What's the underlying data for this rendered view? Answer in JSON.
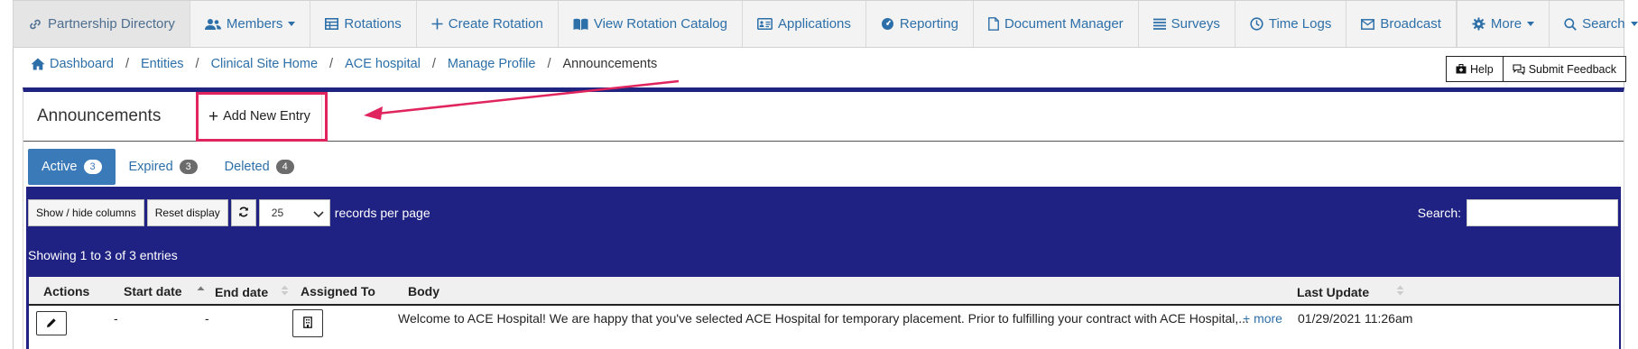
{
  "navbar": {
    "items": [
      {
        "label": "Partnership Directory",
        "icon": "link-icon",
        "active": true
      },
      {
        "label": "Members",
        "icon": "users-icon",
        "dropdown": true
      },
      {
        "label": "Rotations",
        "icon": "table-icon"
      },
      {
        "label": "Create Rotation",
        "icon": "plus-icon"
      },
      {
        "label": "View Rotation Catalog",
        "icon": "book-icon"
      },
      {
        "label": "Applications",
        "icon": "id-card-icon"
      },
      {
        "label": "Reporting",
        "icon": "dashboard-icon"
      },
      {
        "label": "Document Manager",
        "icon": "file-icon"
      },
      {
        "label": "Surveys",
        "icon": "list-icon"
      },
      {
        "label": "Time Logs",
        "icon": "clock-icon"
      },
      {
        "label": "Broadcast",
        "icon": "envelope-icon"
      }
    ],
    "more": {
      "label": "More",
      "icon": "gear-icon"
    },
    "search": {
      "label": "Search",
      "icon": "search-icon"
    }
  },
  "breadcrumb": {
    "items": [
      "Dashboard",
      "Entities",
      "Clinical Site Home",
      "ACE hospital",
      "Manage Profile"
    ],
    "current": "Announcements"
  },
  "help": {
    "help_label": "Help",
    "feedback_label": "Submit Feedback"
  },
  "panel": {
    "title": "Announcements",
    "add_entry_label": "Add New Entry"
  },
  "tabs": [
    {
      "label": "Active",
      "count": "3",
      "active": true
    },
    {
      "label": "Expired",
      "count": "3"
    },
    {
      "label": "Deleted",
      "count": "4"
    }
  ],
  "toolbar": {
    "show_hide_label": "Show / hide columns",
    "reset_label": "Reset display",
    "page_size": "25",
    "per_page_label": "records per page",
    "search_label": "Search:",
    "search_value": ""
  },
  "showing_text": "Showing 1 to 3 of 3 entries",
  "table": {
    "columns": [
      "Actions",
      "Start date",
      "End date",
      "Assigned To",
      "Body",
      "Last Update"
    ],
    "rows": [
      {
        "start": "-",
        "end": "-",
        "body": "Welcome to ACE Hospital! We are happy that you've selected ACE Hospital for temporary placement. Prior to fulfilling your contract with ACE Hospital,...",
        "more": "+ more",
        "last_update": "01/29/2021 11:26am"
      }
    ]
  },
  "colors": {
    "accent": "#2d6fa8",
    "table_bg": "#1f2283",
    "annotation": "#e0245e"
  }
}
